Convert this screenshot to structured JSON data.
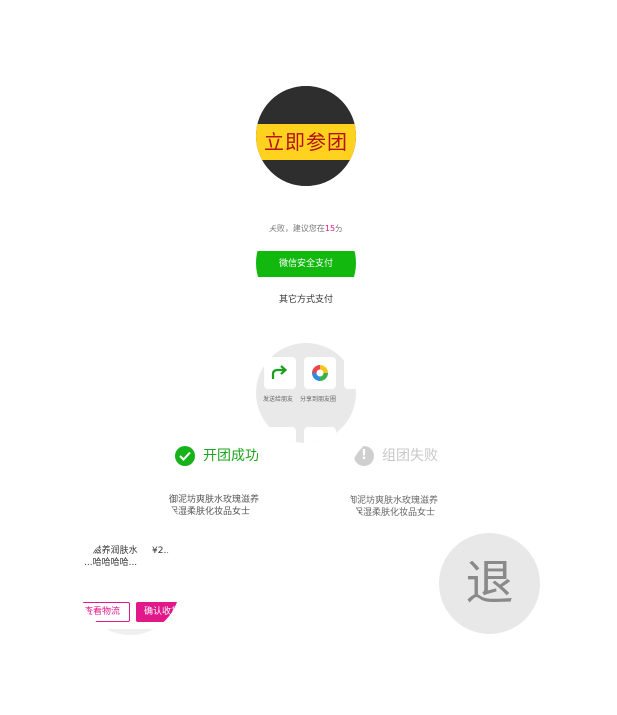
{
  "join_button": {
    "label": "立即参团"
  },
  "payment": {
    "notice_prefix": "失败，建议您在",
    "notice_highlight": "15",
    "notice_suffix": "分",
    "wechat_pay_label": "微信安全支付",
    "other_pay_label": "其它方式支付"
  },
  "share_panel": {
    "items": [
      {
        "label": "发送给朋友",
        "icon": "share-arrow-icon"
      },
      {
        "label": "分享到朋友圈",
        "icon": "moments-icon"
      }
    ]
  },
  "success_state": {
    "title": "开团成功",
    "product_line1": "御泥坊爽肤水玫瑰滋养",
    "product_line2": "保湿柔肤化妆品女士"
  },
  "fail_state": {
    "title": "组团失败",
    "product_line1": "御泥坊爽肤水玫瑰滋养",
    "product_line2": "保湿柔肤化妆品女士"
  },
  "order_item": {
    "name_line1": "...滋养润肤水",
    "name_line2": "...哈哈哈哈...",
    "price": "¥2...",
    "track_button": "查看物流",
    "confirm_button": "确认收货"
  },
  "refund_badge": {
    "label": "退"
  },
  "colors": {
    "accent_pink": "#e0188a",
    "wechat_green": "#12b80e",
    "success_green": "#16b21a",
    "join_yellow": "#ffd21f",
    "join_red": "#b31313"
  }
}
